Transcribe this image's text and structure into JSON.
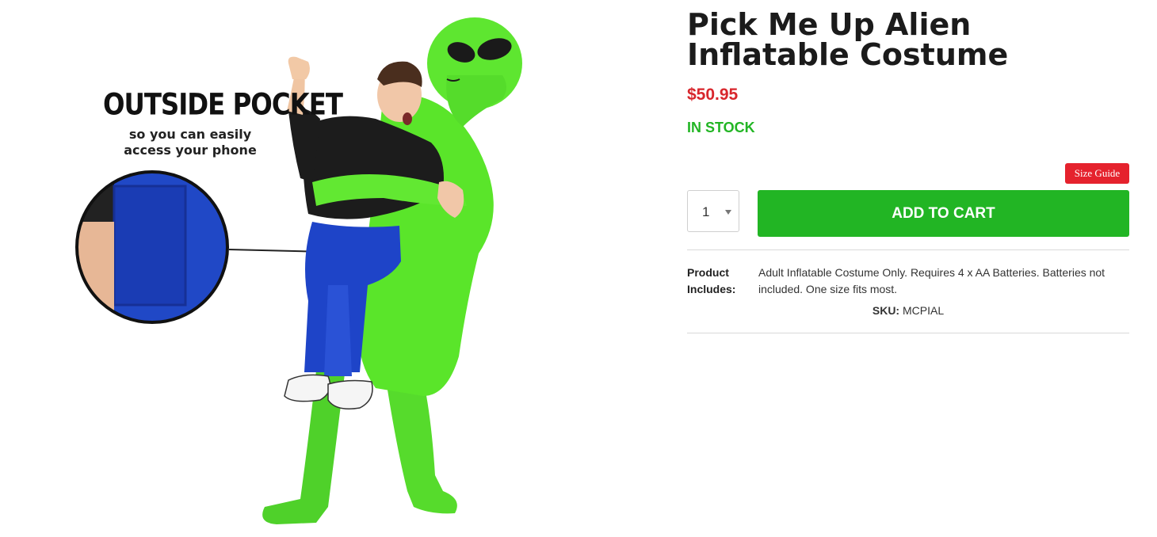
{
  "product": {
    "title": "Pick Me Up Alien Inflatable Costume",
    "price": "$50.95",
    "stock": "IN STOCK",
    "size_guide": "Size Guide",
    "quantity": "1",
    "add_to_cart": "ADD TO CART",
    "includes_label": "Product Includes:",
    "includes_value": "Adult Inflatable Costume Only. Requires 4 x AA Batteries. Batteries not included. One size fits most.",
    "sku_label": "SKU:",
    "sku_value": "MCPIAL"
  },
  "image": {
    "callout_title": "OUTSIDE POCKET",
    "callout_sub": "so you can easily access your phone"
  },
  "colors": {
    "price": "#d8262c",
    "stock": "#22b524",
    "cart_button": "#22b524",
    "size_guide": "#e5222d",
    "alien_green": "#5ae52a",
    "pants_blue": "#1e44c8"
  }
}
